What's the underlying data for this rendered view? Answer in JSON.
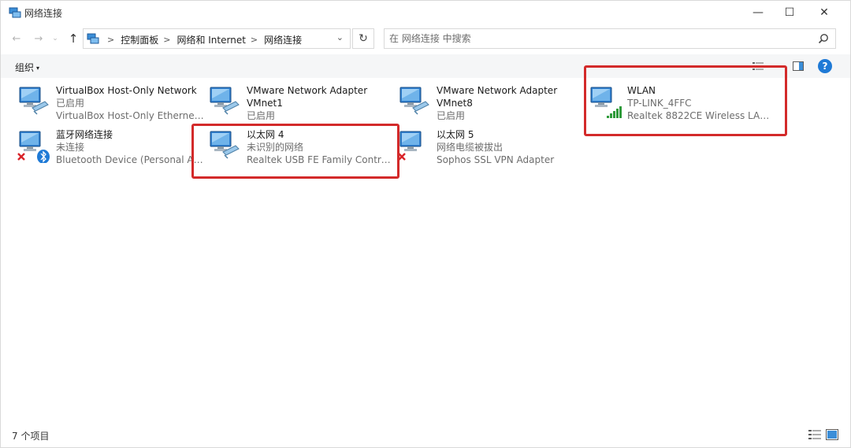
{
  "window": {
    "title": "网络连接",
    "controls": {
      "minimize": "—",
      "maximize": "☐",
      "close": "✕"
    }
  },
  "nav": {
    "back": "←",
    "forward": "→",
    "recent": "⌄",
    "up": "↑",
    "breadcrumbs": [
      "控制面板",
      "网络和 Internet",
      "网络连接"
    ],
    "refresh": "↻",
    "search_placeholder": "在 网络连接 中搜索"
  },
  "commandbar": {
    "organize_label": "组织",
    "organize_arrow": "▾",
    "help": "?"
  },
  "items": [
    {
      "name": "VirtualBox Host-Only Network",
      "name2": "",
      "status": "已启用",
      "device": "VirtualBox Host-Only Ethernet ...",
      "overlay": "none"
    },
    {
      "name": "VMware Network Adapter",
      "name2": "VMnet1",
      "status": "已启用",
      "device": "",
      "overlay": "none"
    },
    {
      "name": "VMware Network Adapter",
      "name2": "VMnet8",
      "status": "已启用",
      "device": "",
      "overlay": "none"
    },
    {
      "name": "WLAN",
      "name2": "",
      "status": "TP-LINK_4FFC",
      "device": "Realtek 8822CE Wireless LAN ...",
      "overlay": "signal"
    },
    {
      "name": "蓝牙网络连接",
      "name2": "",
      "status": "未连接",
      "device": "Bluetooth Device (Personal Ar...",
      "overlay": "bluetooth-disconnected"
    },
    {
      "name": "以太网 4",
      "name2": "",
      "status": "未识别的网络",
      "device": "Realtek USB FE Family Controll...",
      "overlay": "none"
    },
    {
      "name": "以太网 5",
      "name2": "",
      "status": "网络电缆被拔出",
      "device": "Sophos SSL VPN Adapter",
      "overlay": "disconnected"
    }
  ],
  "colors": {
    "highlight": "#d32a2a",
    "accent": "#1f7ad6",
    "signal": "#2e9a3a",
    "error": "#d9242a"
  },
  "status": {
    "count_label": "7 个项目"
  }
}
